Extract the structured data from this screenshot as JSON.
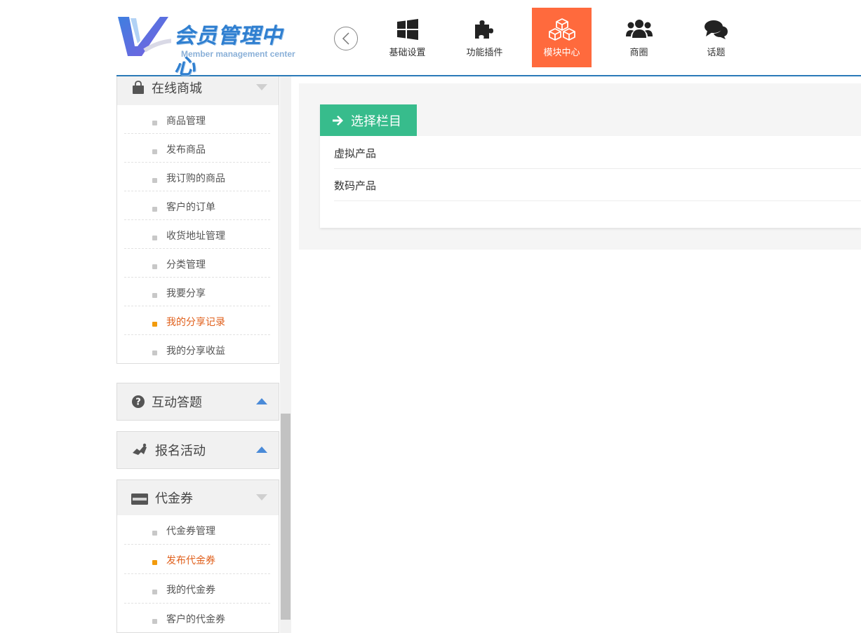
{
  "header": {
    "logo_cn": "会员管理中心",
    "logo_en": "Member management center",
    "nav": [
      {
        "label": "基础设置",
        "icon": "windows-icon"
      },
      {
        "label": "功能插件",
        "icon": "puzzle-icon"
      },
      {
        "label": "模块中心",
        "icon": "cubes-icon",
        "active": true
      },
      {
        "label": "商圈",
        "icon": "users-icon"
      },
      {
        "label": "话题",
        "icon": "comments-icon"
      }
    ],
    "accent_color": "#ff6a3d",
    "line_color": "#2a7ab8"
  },
  "sidebar": {
    "shop": {
      "title": "在线商城",
      "icon": "shopping-bag-icon",
      "items": [
        "商品管理",
        "发布商品",
        "我订购的商品",
        "客户的订单",
        "收货地址管理",
        "分类管理",
        "我要分享",
        "我的分享记录",
        "我的分享收益"
      ],
      "active_index": 7
    },
    "qa": {
      "title": "互动答题",
      "icon": "question-circle-icon"
    },
    "signup": {
      "title": "报名活动",
      "icon": "activity-icon"
    },
    "voucher": {
      "title": "代金券",
      "icon": "credit-card-icon",
      "items": [
        "代金券管理",
        "发布代金券",
        "我的代金券",
        "客户的代金券"
      ],
      "active_index": 1
    }
  },
  "content": {
    "tab_label": "选择栏目",
    "tab_color": "#37bc8c",
    "categories": [
      "虚拟产品",
      "数码产品"
    ]
  }
}
